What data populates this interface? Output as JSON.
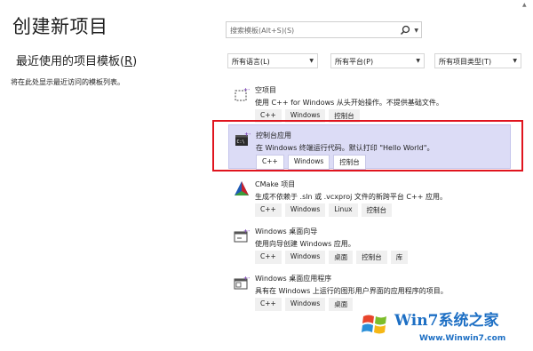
{
  "page_title": "创建新项目",
  "recent": {
    "title_prefix": "最近使用的项目模板(",
    "title_key": "R",
    "title_suffix": ")",
    "hint": "将在此处显示最近访问的模板列表。"
  },
  "search": {
    "placeholder": "搜索模板(Alt+S)(S)"
  },
  "filters": [
    {
      "label": "所有语言(L)"
    },
    {
      "label": "所有平台(P)"
    },
    {
      "label": "所有项目类型(T)"
    }
  ],
  "templates": [
    {
      "name": "空项目",
      "description": "使用 C++ for Windows 从头开始操作。不提供基础文件。",
      "tags": [
        "C++",
        "Windows",
        "控制台"
      ],
      "selected": false,
      "icon": "empty-project-icon"
    },
    {
      "name": "控制台应用",
      "description": "在 Windows 终端运行代码。默认打印 \"Hello World\"。",
      "tags": [
        "C++",
        "Windows",
        "控制台"
      ],
      "selected": true,
      "icon": "console-app-icon"
    },
    {
      "name": "CMake 项目",
      "description": "生成不依赖于 .sln 或 .vcxproj 文件的新跨平台 C++ 应用。",
      "tags": [
        "C++",
        "Windows",
        "Linux",
        "控制台"
      ],
      "selected": false,
      "icon": "cmake-icon"
    },
    {
      "name": "Windows 桌面向导",
      "description": "使用向导创建 Windows 应用。",
      "tags": [
        "C++",
        "Windows",
        "桌面",
        "控制台",
        "库"
      ],
      "selected": false,
      "icon": "desktop-wizard-icon"
    },
    {
      "name": "Windows 桌面应用程序",
      "description": "具有在 Windows 上运行的图形用户界面的应用程序的项目。",
      "tags": [
        "C++",
        "Windows",
        "桌面"
      ],
      "selected": false,
      "icon": "desktop-app-icon"
    }
  ],
  "watermark": {
    "brand": "Win7系统之家",
    "url": "Www.Winwin7.com"
  },
  "colors": {
    "selected_bg": "#dcdcf6",
    "highlight_border": "#e0141e",
    "accent": "#1d6fc4"
  }
}
